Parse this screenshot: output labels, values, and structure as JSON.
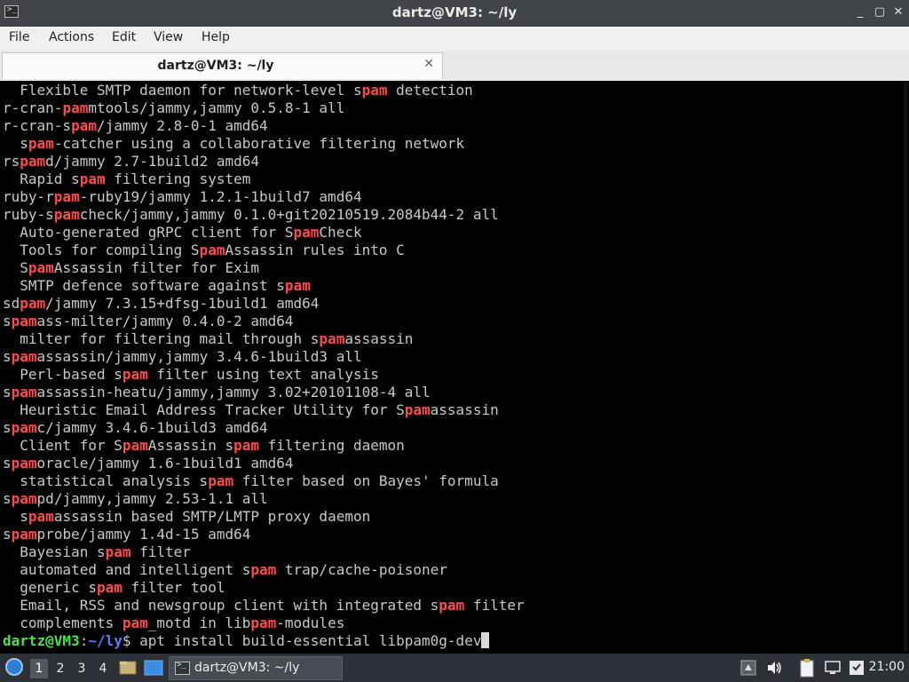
{
  "window": {
    "title": "dartz@VM3: ~/ly",
    "app_icon_glyph": ">_",
    "minimize_glyph": "_",
    "maximize_glyph": "▢",
    "close_glyph": "✕"
  },
  "menu": [
    "File",
    "Actions",
    "Edit",
    "View",
    "Help"
  ],
  "tab": {
    "title": "dartz@VM3: ~/ly",
    "close_glyph": "✕"
  },
  "terminal": {
    "lines": [
      [
        [
          "  Flexible SMTP daemon for network-level s",
          ""
        ],
        [
          "pam",
          "hl"
        ],
        [
          " detection",
          ""
        ]
      ],
      [
        [
          "r-cran-",
          ""
        ],
        [
          "pam",
          "hl"
        ],
        [
          "mtools/jammy,jammy 0.5.8-1 all",
          ""
        ]
      ],
      [
        [
          "r-cran-s",
          ""
        ],
        [
          "pam",
          "hl"
        ],
        [
          "/jammy 2.8-0-1 amd64",
          ""
        ]
      ],
      [
        [
          "  s",
          ""
        ],
        [
          "pam",
          "hl"
        ],
        [
          "-catcher using a collaborative filtering network",
          ""
        ]
      ],
      [
        [
          "rs",
          ""
        ],
        [
          "pam",
          "hl"
        ],
        [
          "d/jammy 2.7-1build2 amd64",
          ""
        ]
      ],
      [
        [
          "  Rapid s",
          ""
        ],
        [
          "pam",
          "hl"
        ],
        [
          " filtering system",
          ""
        ]
      ],
      [
        [
          "ruby-r",
          ""
        ],
        [
          "pam",
          "hl"
        ],
        [
          "-ruby19/jammy 1.2.1-1build7 amd64",
          ""
        ]
      ],
      [
        [
          "ruby-s",
          ""
        ],
        [
          "pam",
          "hl"
        ],
        [
          "check/jammy,jammy 0.1.0+git20210519.2084b44-2 all",
          ""
        ]
      ],
      [
        [
          "  Auto-generated gRPC client for S",
          ""
        ],
        [
          "pam",
          "hl"
        ],
        [
          "Check",
          ""
        ]
      ],
      [
        [
          "  Tools for compiling S",
          ""
        ],
        [
          "pam",
          "hl"
        ],
        [
          "Assassin rules into C",
          ""
        ]
      ],
      [
        [
          "  S",
          ""
        ],
        [
          "pam",
          "hl"
        ],
        [
          "Assassin filter for Exim",
          ""
        ]
      ],
      [
        [
          "  SMTP defence software against s",
          ""
        ],
        [
          "pam",
          "hl"
        ]
      ],
      [
        [
          "sd",
          ""
        ],
        [
          "pam",
          "hl"
        ],
        [
          "/jammy 7.3.15+dfsg-1build1 amd64",
          ""
        ]
      ],
      [
        [
          "s",
          ""
        ],
        [
          "pam",
          "hl"
        ],
        [
          "ass-milter/jammy 0.4.0-2 amd64",
          ""
        ]
      ],
      [
        [
          "  milter for filtering mail through s",
          ""
        ],
        [
          "pam",
          "hl"
        ],
        [
          "assassin",
          ""
        ]
      ],
      [
        [
          "s",
          ""
        ],
        [
          "pam",
          "hl"
        ],
        [
          "assassin/jammy,jammy 3.4.6-1build3 all",
          ""
        ]
      ],
      [
        [
          "  Perl-based s",
          ""
        ],
        [
          "pam",
          "hl"
        ],
        [
          " filter using text analysis",
          ""
        ]
      ],
      [
        [
          "s",
          ""
        ],
        [
          "pam",
          "hl"
        ],
        [
          "assassin-heatu/jammy,jammy 3.02+20101108-4 all",
          ""
        ]
      ],
      [
        [
          "  Heuristic Email Address Tracker Utility for S",
          ""
        ],
        [
          "pam",
          "hl"
        ],
        [
          "assassin",
          ""
        ]
      ],
      [
        [
          "s",
          ""
        ],
        [
          "pam",
          "hl"
        ],
        [
          "c/jammy 3.4.6-1build3 amd64",
          ""
        ]
      ],
      [
        [
          "  Client for S",
          ""
        ],
        [
          "pam",
          "hl"
        ],
        [
          "Assassin s",
          ""
        ],
        [
          "pam",
          "hl"
        ],
        [
          " filtering daemon",
          ""
        ]
      ],
      [
        [
          "s",
          ""
        ],
        [
          "pam",
          "hl"
        ],
        [
          "oracle/jammy 1.6-1build1 amd64",
          ""
        ]
      ],
      [
        [
          "  statistical analysis s",
          ""
        ],
        [
          "pam",
          "hl"
        ],
        [
          " filter based on Bayes' formula",
          ""
        ]
      ],
      [
        [
          "s",
          ""
        ],
        [
          "pam",
          "hl"
        ],
        [
          "pd/jammy,jammy 2.53-1.1 all",
          ""
        ]
      ],
      [
        [
          "  s",
          ""
        ],
        [
          "pam",
          "hl"
        ],
        [
          "assassin based SMTP/LMTP proxy daemon",
          ""
        ]
      ],
      [
        [
          "s",
          ""
        ],
        [
          "pam",
          "hl"
        ],
        [
          "probe/jammy 1.4d-15 amd64",
          ""
        ]
      ],
      [
        [
          "  Bayesian s",
          ""
        ],
        [
          "pam",
          "hl"
        ],
        [
          " filter",
          ""
        ]
      ],
      [
        [
          "  automated and intelligent s",
          ""
        ],
        [
          "pam",
          "hl"
        ],
        [
          " trap/cache-poisoner",
          ""
        ]
      ],
      [
        [
          "  generic s",
          ""
        ],
        [
          "pam",
          "hl"
        ],
        [
          " filter tool",
          ""
        ]
      ],
      [
        [
          "  Email, RSS and newsgroup client with integrated s",
          ""
        ],
        [
          "pam",
          "hl"
        ],
        [
          " filter",
          ""
        ]
      ],
      [
        [
          "  complements ",
          ""
        ],
        [
          "pam",
          "hl"
        ],
        [
          "_motd in lib",
          ""
        ],
        [
          "pam",
          "hl"
        ],
        [
          "-modules",
          ""
        ]
      ]
    ],
    "prompt": {
      "user_host": "dartz@VM3",
      "sep": ":",
      "path": "~/ly",
      "dollar": "$ ",
      "command": "apt install build-essential libpam0g-dev"
    }
  },
  "taskbar": {
    "workspaces": [
      "1",
      "2",
      "3",
      "4"
    ],
    "active_workspace": "1",
    "task_label": "dartz@VM3: ~/ly",
    "clock": "21:00"
  },
  "colors": {
    "highlight": "#ff4a4a",
    "prompt_user": "#49e24a",
    "prompt_path": "#5a7cff",
    "terminal_bg": "#000000"
  }
}
